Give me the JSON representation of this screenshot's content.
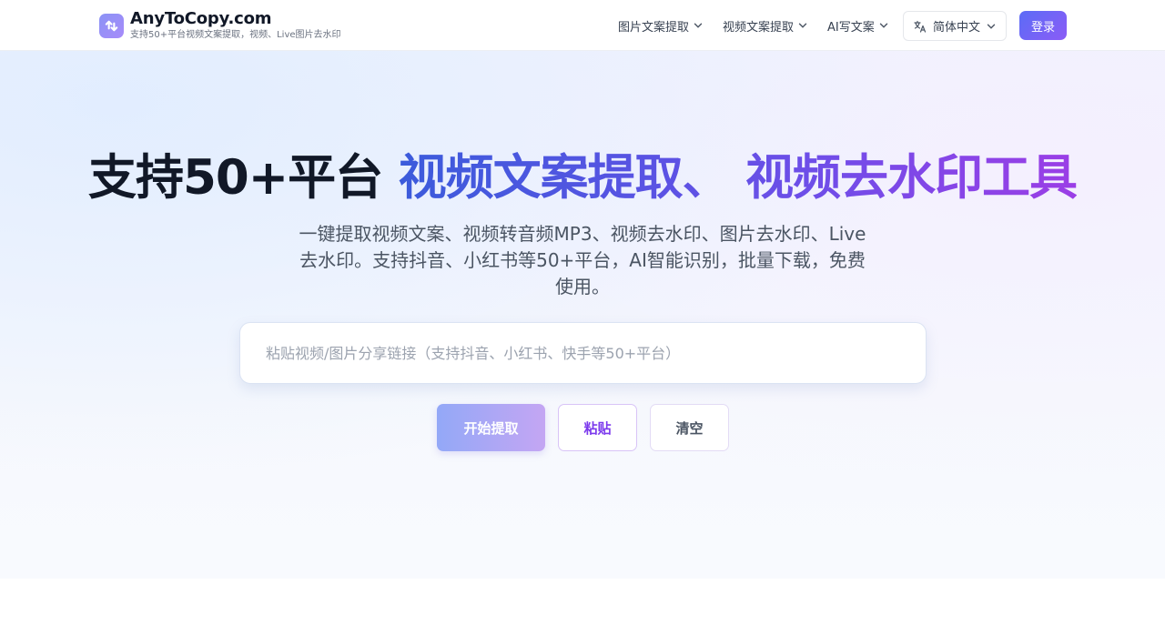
{
  "brand": {
    "name": "AnyToCopy.com",
    "tagline": "支持50+平台视频文案提取，视频、Live图片去水印"
  },
  "nav": {
    "items": [
      {
        "label": "图片文案提取"
      },
      {
        "label": "视频文案提取"
      },
      {
        "label": "AI写文案"
      }
    ],
    "language": "简体中文",
    "login": "登录"
  },
  "hero": {
    "title_dark": "支持50+平台",
    "title_gradient": "视频文案提取、 视频去水印工具",
    "description": "一键提取视频文案、视频转音频MP3、视频去水印、图片去水印、Live去水印。支持抖音、小红书等50+平台，AI智能识别，批量下载，免费使用。",
    "input_placeholder": "粘贴视频/图片分享链接（支持抖音、小红书、快手等50+平台）",
    "input_value": "",
    "buttons": {
      "start": "开始提取",
      "paste": "粘贴",
      "clear": "清空"
    }
  },
  "icons": {
    "logo": "app-logo-icon",
    "translate": "translate-icon",
    "chevron": "chevron-down-icon"
  },
  "colors": {
    "accent": "#5b6cf6",
    "accent_purple": "#8b5cf6",
    "title_blue": "#3b5bdb",
    "title_purple": "#9b3ee6"
  }
}
